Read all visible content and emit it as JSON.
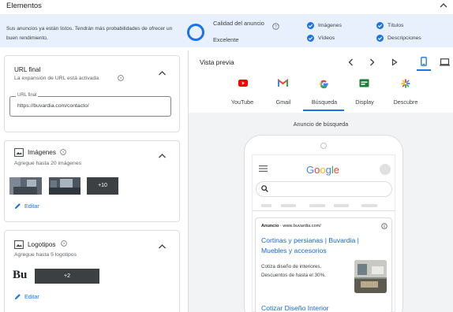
{
  "header": {
    "title": "Elementos"
  },
  "strip": {
    "message": "Sus anuncios ya están listos. Tendrán más probabilidades de ofrecer un buen rendimiento.",
    "quality_title": "Calidad del anuncio",
    "quality_value": "Excelente",
    "checks": [
      {
        "label": "Imágenes"
      },
      {
        "label": "Títulos"
      },
      {
        "label": "Vídeos"
      },
      {
        "label": "Descripciones"
      }
    ]
  },
  "url_card": {
    "title": "URL final",
    "subtitle": "La expansión de URL está activada",
    "field_label": "URL final",
    "field_value": "https://buvardia.com/contacto/"
  },
  "images_card": {
    "title": "Imágenes",
    "subtitle": "Agregue hasta 20 imágenes",
    "more_count": "+10",
    "edit_label": "Editar"
  },
  "logos_card": {
    "title": "Logotipos",
    "subtitle": "Agregue hasta 5 logotipos",
    "logo_text": "Bu",
    "more_count": "+2",
    "edit_label": "Editar"
  },
  "preview": {
    "title": "Vista previa",
    "tabs": [
      {
        "label": "YouTube"
      },
      {
        "label": "Gmail"
      },
      {
        "label": "Búsqueda"
      },
      {
        "label": "Display"
      },
      {
        "label": "Descubre"
      }
    ],
    "selected_tab": "Búsqueda",
    "ad_type_label": "Anuncio de búsqueda"
  },
  "phone": {
    "search_logo": "Google",
    "ad_badge": "Anuncio",
    "ad_domain": "· www.buvardia.com/",
    "ad_title": "Cortinas y persianas | Buvardia | Muebles y accesorios",
    "ad_description": "Cotiza diseño de interiores. Descuentos de hasta el 30%.",
    "ad_title_2": "Cotizar Diseño Interior"
  },
  "colors": {
    "accent": "#1a73e8",
    "strip_bg": "#e8f0fe",
    "link": "#1967d2",
    "youtube": "#ff0000",
    "sheets": "#188038"
  }
}
